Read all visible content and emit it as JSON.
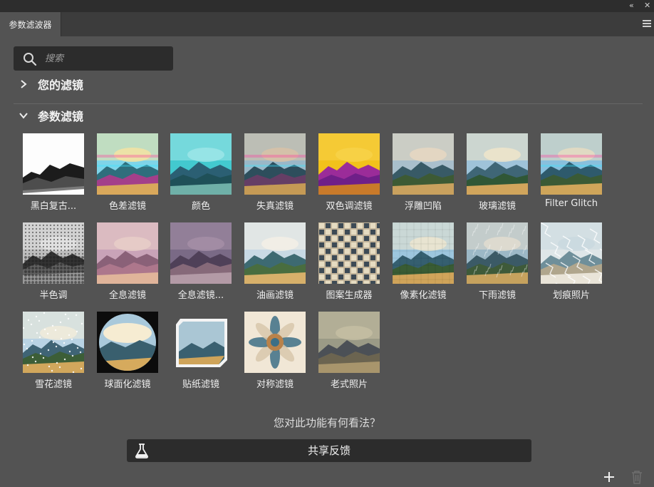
{
  "panel": {
    "collapse_glyph": "«",
    "close_glyph": "✕",
    "tab_title": "参数滤波器"
  },
  "search": {
    "placeholder": "搜索"
  },
  "sections": {
    "your_filters": "您的滤镜",
    "param_filters": "参数滤镜"
  },
  "filters": [
    {
      "label": "黑白复古...",
      "style": "bw"
    },
    {
      "label": "色差滤镜",
      "style": "chromatic"
    },
    {
      "label": "颜色",
      "style": "teal"
    },
    {
      "label": "失真滤镜",
      "style": "distort"
    },
    {
      "label": "双色调滤镜",
      "style": "duotone"
    },
    {
      "label": "浮雕凹陷",
      "style": "emboss"
    },
    {
      "label": "玻璃滤镜",
      "style": "glass"
    },
    {
      "label": "Filter Glitch",
      "style": "glitch"
    },
    {
      "label": "半色调",
      "style": "halftone"
    },
    {
      "label": "全息滤镜",
      "style": "holo"
    },
    {
      "label": "全息滤镜...",
      "style": "holo2"
    },
    {
      "label": "油画滤镜",
      "style": "oil"
    },
    {
      "label": "图案生成器",
      "style": "pattern"
    },
    {
      "label": "像素化滤镜",
      "style": "pixel"
    },
    {
      "label": "下雨滤镜",
      "style": "rain"
    },
    {
      "label": "划痕照片",
      "style": "scratch"
    },
    {
      "label": "雪花滤镜",
      "style": "snow"
    },
    {
      "label": "球面化滤镜",
      "style": "sphere"
    },
    {
      "label": "贴纸滤镜",
      "style": "sticker"
    },
    {
      "label": "对称滤镜",
      "style": "symmetry"
    },
    {
      "label": "老式照片",
      "style": "oldphoto"
    }
  ],
  "feedback": {
    "question": "您对此功能有何看法？",
    "button_label": "共享反馈"
  },
  "icons": [
    "collapse-icon",
    "close-icon",
    "panel-menu-icon",
    "search-icon",
    "chevron-right-icon",
    "chevron-down-icon",
    "flask-icon",
    "add-icon",
    "trash-icon"
  ]
}
